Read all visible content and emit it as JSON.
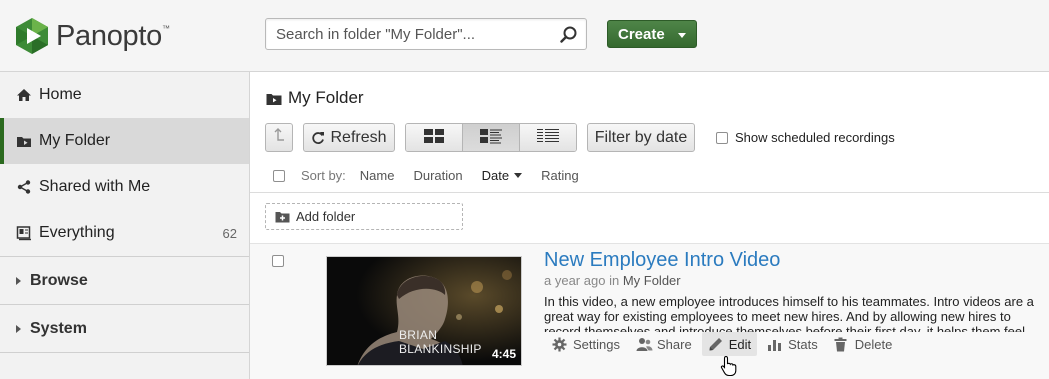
{
  "header": {
    "logo_text": "Panopto",
    "logo_tm": "™",
    "search": {
      "placeholder": "Search in folder \"My Folder\"...",
      "value": ""
    },
    "create_label": "Create"
  },
  "sidebar": {
    "items": [
      {
        "label": "Home",
        "icon": "home-icon"
      },
      {
        "label": "My Folder",
        "icon": "folder-icon",
        "active": true
      },
      {
        "label": "Shared with Me",
        "icon": "share-icon"
      },
      {
        "label": "Everything",
        "icon": "everything-icon",
        "count": "62"
      }
    ],
    "sections": [
      {
        "label": "Browse"
      },
      {
        "label": "System"
      }
    ]
  },
  "main": {
    "folder_title": "My Folder",
    "toolbar": {
      "refresh_label": "Refresh",
      "filter_label": "Filter by date",
      "scheduled_label": "Show scheduled recordings",
      "active_view": "detail-list"
    },
    "sort": {
      "label": "Sort by:",
      "options": [
        "Name",
        "Duration",
        "Date",
        "Rating"
      ],
      "active": "Date"
    },
    "add_folder_label": "Add folder",
    "sessions": [
      {
        "title": "New Employee Intro Video",
        "age": "a year ago",
        "in_label": "in",
        "folder": "My Folder",
        "description": "In this video, a new employee introduces himself to his teammates. Intro videos are a great way for existing employees to meet new hires. And by allowing new hires to record themselves and introduce themselves before their first day, it helps them feel familiar",
        "thumbnail_caption": "BRIAN BLANKINSHIP",
        "duration": "4:45",
        "actions": [
          "Settings",
          "Share",
          "Edit",
          "Stats",
          "Delete"
        ],
        "hovered_action": "Edit"
      }
    ]
  },
  "colors": {
    "brand_green": "#35692f",
    "link_blue": "#2b7bbf",
    "active_nav_border": "#2b6a1f"
  }
}
